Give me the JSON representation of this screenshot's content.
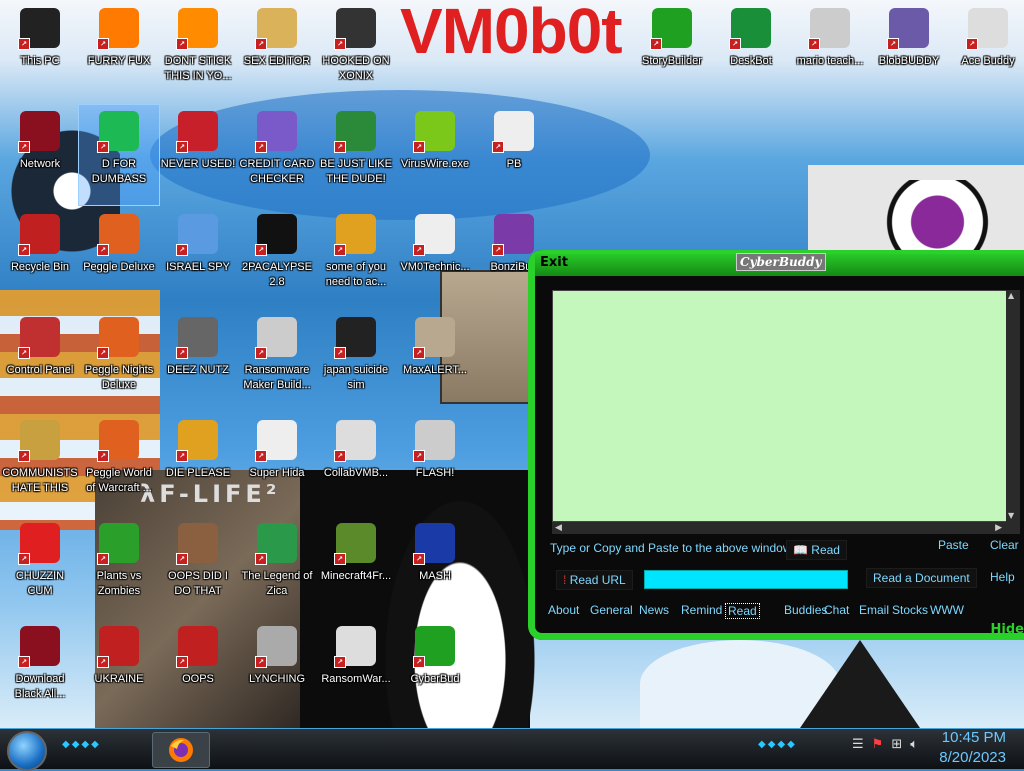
{
  "wallpaper": {
    "banner_text": "VM0b0t",
    "accent_color": "#e02020"
  },
  "desktop_icons": [
    {
      "label": "This PC",
      "icon": "monitor-icon",
      "color": "#222222"
    },
    {
      "label": "FURRY FUX",
      "icon": "firefox-icon",
      "color": "#ff7a00"
    },
    {
      "label": "DONT STICK THIS IN YO...",
      "icon": "vlc-cone-icon",
      "color": "#ff8c00"
    },
    {
      "label": "SEX EDITOR",
      "icon": "hxd-icon",
      "color": "#d9b25a"
    },
    {
      "label": "HOOKED ON XONIX",
      "icon": "xonix-icon",
      "color": "#333333"
    },
    {
      "label": "StoryBuilder",
      "icon": "duck-icon",
      "color": "#20a020"
    },
    {
      "label": "DeskBot",
      "icon": "deskbot-icon",
      "color": "#1a8f3a"
    },
    {
      "label": "mario teach...",
      "icon": "book-icon",
      "color": "#cccccc"
    },
    {
      "label": "BlobBUDDY",
      "icon": "blob-icon",
      "color": "#6b5aa8"
    },
    {
      "label": "Ace Buddy",
      "icon": "chef-icon",
      "color": "#dddddd"
    },
    {
      "label": "Network",
      "icon": "network-icon",
      "color": "#8a1020"
    },
    {
      "label": "D FOR DUMBASS",
      "icon": "chat-bubble-icon",
      "color": "#1db954"
    },
    {
      "label": "NEVER USED!",
      "icon": "devcpp-icon",
      "color": "#c8202a"
    },
    {
      "label": "CREDIT CARD CHECKER",
      "icon": "credit-card-icon",
      "color": "#7a5ac8"
    },
    {
      "label": "BE JUST LIKE THE DUDE!",
      "icon": "elf-icon",
      "color": "#2a8a3a"
    },
    {
      "label": "VirusWire.exe",
      "icon": "lime-icon",
      "color": "#7cc81a"
    },
    {
      "label": "PB",
      "icon": "flag-icon",
      "color": "#eeeeee"
    },
    {
      "label": "Recycle Bin",
      "icon": "recycle-bin-icon",
      "color": "#c02020"
    },
    {
      "label": "Peggle Deluxe",
      "icon": "peggle-icon",
      "color": "#e06020"
    },
    {
      "label": "ISRAEL SPY",
      "icon": "spy-icon",
      "color": "#5a9ae0"
    },
    {
      "label": "2PACALYPSE 2.8",
      "icon": "terminal-icon",
      "color": "#111111"
    },
    {
      "label": "some of you need to ac...",
      "icon": "dog-icon",
      "color": "#e0a020"
    },
    {
      "label": "VM0Technic...",
      "icon": "doctor-icon",
      "color": "#eeeeee"
    },
    {
      "label": "BonziBud",
      "icon": "bonzi-icon",
      "color": "#7a3aa8"
    },
    {
      "label": "Control Panel",
      "icon": "control-panel-icon",
      "color": "#c03030"
    },
    {
      "label": "Peggle Nights Deluxe",
      "icon": "peggle-icon",
      "color": "#e06020"
    },
    {
      "label": "DEEZ NUTZ",
      "icon": "windows-stack-icon",
      "color": "#666666"
    },
    {
      "label": "Ransomware Maker Build...",
      "icon": "window-app-icon",
      "color": "#cccccc"
    },
    {
      "label": "japan suicide sim",
      "icon": "game-icon",
      "color": "#222222"
    },
    {
      "label": "MaxALERT...",
      "icon": "computer-guy-icon",
      "color": "#b8a890"
    },
    {
      "label": "COMMUNISTS HATE THIS G...",
      "icon": "money-bag-icon",
      "color": "#c8a040"
    },
    {
      "label": "Peggle World of Warcraft ...",
      "icon": "peggle-icon",
      "color": "#e06020"
    },
    {
      "label": "DIE PLEASE",
      "icon": "de-icon",
      "color": "#e0a020"
    },
    {
      "label": "Super Hida",
      "icon": "pixel-cat-icon",
      "color": "#eeeeee"
    },
    {
      "label": "CollabVMB...",
      "icon": "cassette-icon",
      "color": "#dddddd"
    },
    {
      "label": "FLASH!",
      "icon": "flash-icon",
      "color": "#cccccc"
    },
    {
      "label": "CHUZZIN CUM",
      "icon": "chuzzle-icon",
      "color": "#e02020"
    },
    {
      "label": "Plants vs Zombies",
      "icon": "plant-icon",
      "color": "#2aa02a"
    },
    {
      "label": "OOPS DID I DO THAT",
      "icon": "portrait-icon",
      "color": "#8a6040"
    },
    {
      "label": "The Legend of Zica",
      "icon": "zelda-icon",
      "color": "#2a9a4a"
    },
    {
      "label": "Minecraft4Fr...",
      "icon": "grass-block-icon",
      "color": "#5a8a2a"
    },
    {
      "label": "MASH",
      "icon": "penguin-hat-icon",
      "color": "#1a3aa8"
    },
    {
      "label": "Download Black All...",
      "icon": "network-icon",
      "color": "#8a1020"
    },
    {
      "label": "UKRAINE",
      "icon": "radiation-icon",
      "color": "#c02020"
    },
    {
      "label": "OOPS",
      "icon": "oops-icon",
      "color": "#c02020"
    },
    {
      "label": "LYNCHING",
      "icon": "noose-icon",
      "color": "#aaaaaa"
    },
    {
      "label": "RansomWar...",
      "icon": "skull-icon",
      "color": "#dddddd"
    },
    {
      "label": "CyberBud",
      "icon": "duck-icon",
      "color": "#20a020"
    }
  ],
  "cyberbuddy": {
    "exit_label": "Exit",
    "title": "CyberBuddy",
    "hint": "Type or Copy and Paste to the above window",
    "read_button": "Read",
    "paste_button": "Paste",
    "clear_button": "Clear",
    "read_url_button": "Read URL",
    "url_value": "",
    "read_document_button": "Read a Document",
    "help_button": "Help",
    "tabs": [
      "About",
      "General",
      "News",
      "Remind",
      "Read",
      "Buddies",
      "Chat",
      "Email",
      "Stocks",
      "WWW"
    ],
    "active_tab": "Read",
    "hide_label": "Hide",
    "frame_color": "#2bd12b",
    "pane_color": "#c3f7bc",
    "text_color": "#7fd8ff"
  },
  "taskbar": {
    "start_icon": "start-orb-icon",
    "pinned_app_icon": "firefox-icon",
    "tray_icons": [
      "action-center-icon",
      "warning-flag-icon",
      "network-icon",
      "volume-icon"
    ],
    "clock_time": "10:45 PM",
    "clock_date": "8/20/2023",
    "clock_color": "#6cc8ff"
  }
}
